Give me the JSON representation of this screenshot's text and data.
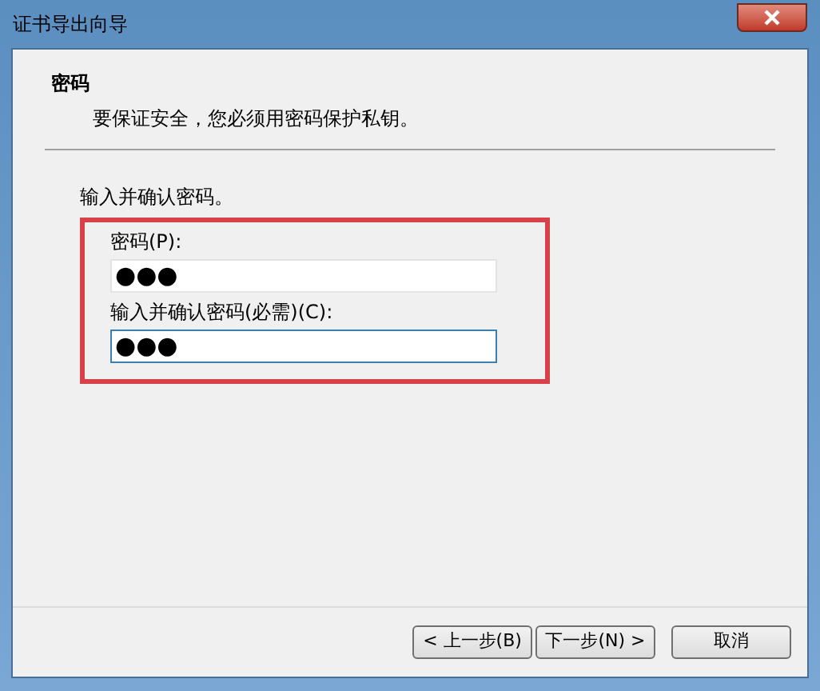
{
  "window": {
    "title": "证书导出向导"
  },
  "header": {
    "title": "密码",
    "subtitle": "要保证安全，您必须用密码保护私钥。"
  },
  "instruction": "输入并确认密码。",
  "fields": [
    {
      "label": "密码(P):",
      "value": "●●●",
      "focused": false
    },
    {
      "label": "输入并确认密码(必需)(C):",
      "value": "●●●",
      "focused": true
    }
  ],
  "buttons": [
    {
      "label": "< 上一步(B)"
    },
    {
      "label": "下一步(N) >"
    },
    {
      "label": "取消"
    }
  ]
}
